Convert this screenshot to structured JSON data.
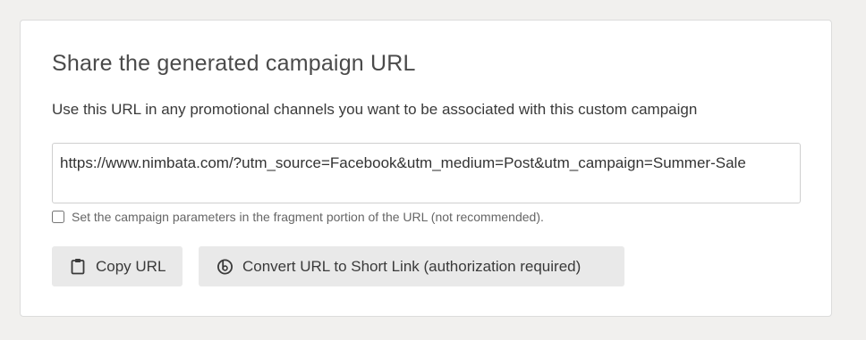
{
  "panel": {
    "title": "Share the generated campaign URL",
    "description": "Use this URL in any promotional channels you want to be associated with this custom campaign",
    "url_value": "https://www.nimbata.com/?utm_source=Facebook&utm_medium=Post&utm_campaign=Summer-Sale",
    "fragment_option": {
      "label": "Set the campaign parameters in the fragment portion of the URL (not recommended).",
      "checked": false
    },
    "buttons": {
      "copy_label": "Copy URL",
      "copy_icon": "clipboard-icon",
      "short_link_label": "Convert URL to Short Link (authorization required)",
      "short_link_icon": "bitly-icon"
    }
  }
}
